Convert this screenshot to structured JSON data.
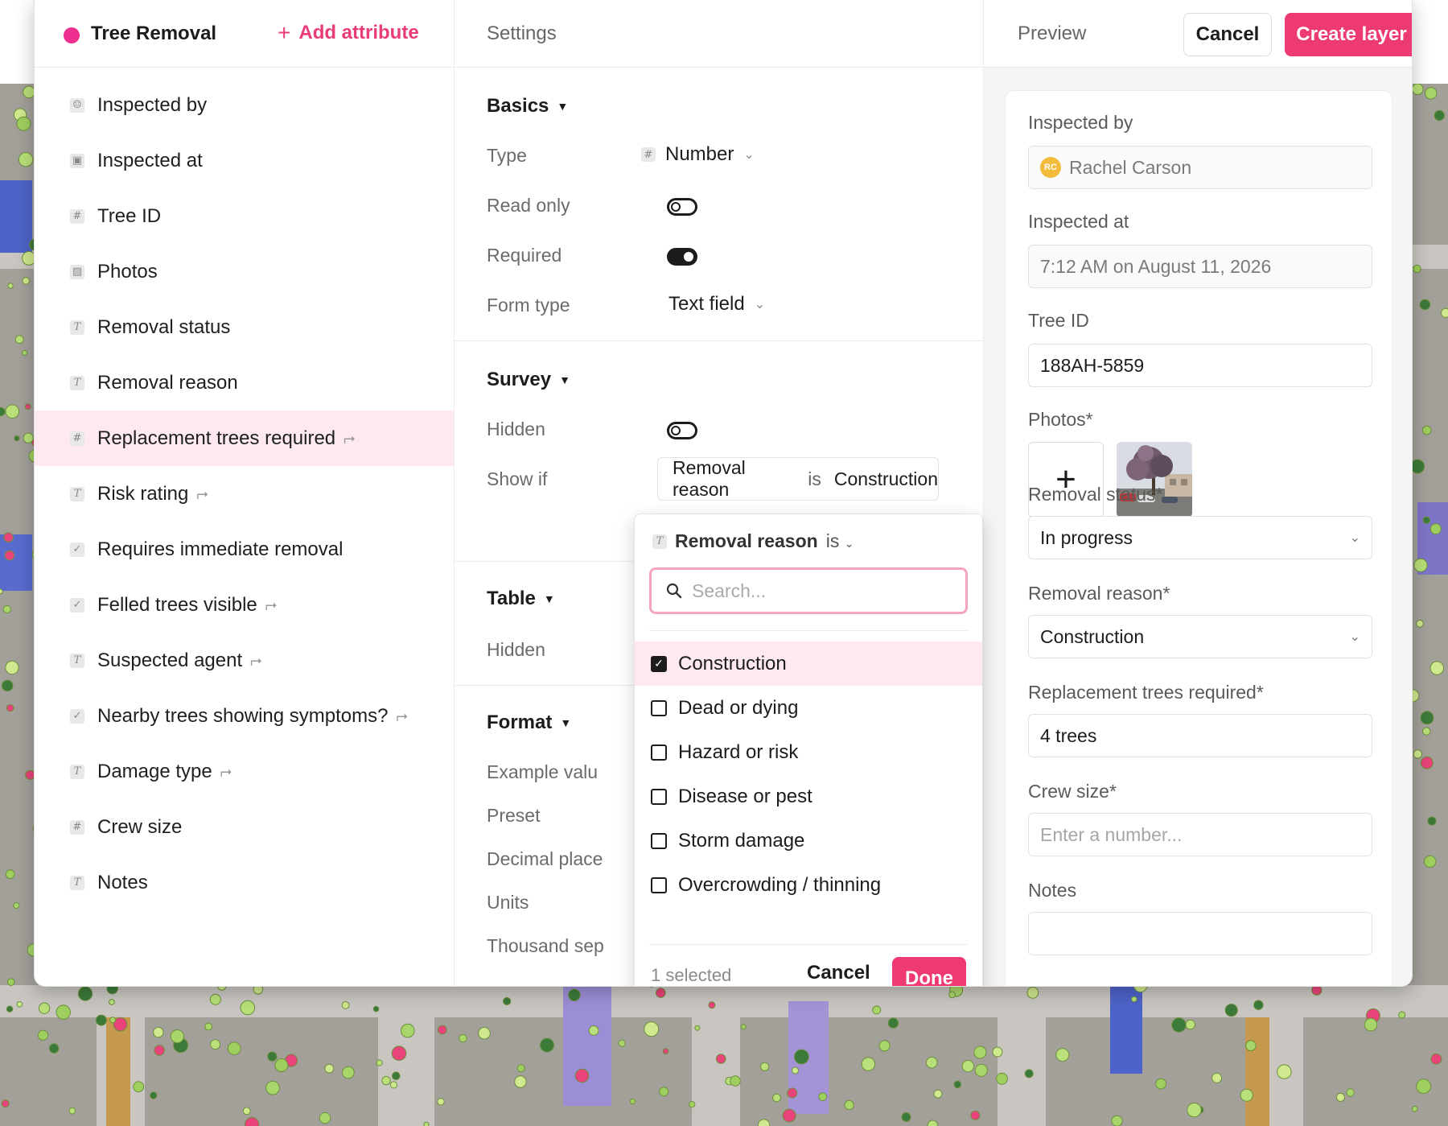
{
  "layer": {
    "name": "Tree Removal",
    "dot_color": "#ee2f8f",
    "add_attribute_label": "Add attribute"
  },
  "attributes": [
    {
      "label": "Inspected by",
      "icon": "person-icon",
      "glyph": "☺",
      "conditional": false
    },
    {
      "label": "Inspected at",
      "icon": "calendar-icon",
      "glyph": "▣",
      "conditional": false
    },
    {
      "label": "Tree ID",
      "icon": "number-icon",
      "glyph": "#",
      "conditional": false
    },
    {
      "label": "Photos",
      "icon": "image-icon",
      "glyph": "▨",
      "conditional": false
    },
    {
      "label": "Removal status",
      "icon": "text-icon",
      "glyph": "T",
      "conditional": false
    },
    {
      "label": "Removal reason",
      "icon": "text-icon",
      "glyph": "T",
      "conditional": false
    },
    {
      "label": "Replacement trees required",
      "icon": "number-icon",
      "glyph": "#",
      "conditional": true,
      "selected": true
    },
    {
      "label": "Risk rating",
      "icon": "text-icon",
      "glyph": "T",
      "conditional": true
    },
    {
      "label": "Requires immediate removal",
      "icon": "checkbox-icon",
      "glyph": "✓",
      "conditional": false
    },
    {
      "label": "Felled trees visible",
      "icon": "checkbox-icon",
      "glyph": "✓",
      "conditional": true
    },
    {
      "label": "Suspected agent",
      "icon": "text-icon",
      "glyph": "T",
      "conditional": true
    },
    {
      "label": "Nearby trees showing symptoms?",
      "icon": "checkbox-icon",
      "glyph": "✓",
      "conditional": true
    },
    {
      "label": "Damage type",
      "icon": "text-icon",
      "glyph": "T",
      "conditional": true
    },
    {
      "label": "Crew size",
      "icon": "number-icon",
      "glyph": "#",
      "conditional": false
    },
    {
      "label": "Notes",
      "icon": "text-icon",
      "glyph": "T",
      "conditional": false
    }
  ],
  "settings": {
    "title": "Settings",
    "basics": {
      "title": "Basics",
      "type_label": "Type",
      "type_value": "Number",
      "read_only_label": "Read only",
      "read_only": false,
      "required_label": "Required",
      "required": true,
      "form_type_label": "Form type",
      "form_type_value": "Text field"
    },
    "survey": {
      "title": "Survey",
      "hidden_label": "Hidden",
      "hidden": false,
      "show_if_label": "Show if",
      "show_if": {
        "field": "Removal reason",
        "op": "is",
        "value": "Construction"
      }
    },
    "table": {
      "title": "Table",
      "hidden_label": "Hidden"
    },
    "format": {
      "title": "Format",
      "rows": [
        "Example valu",
        "Preset",
        "Decimal place",
        "Units",
        "Thousand sep"
      ]
    }
  },
  "dropdown": {
    "field": "Removal reason",
    "op": "is",
    "search_placeholder": "Search...",
    "options": [
      {
        "label": "Construction",
        "checked": true
      },
      {
        "label": "Dead or dying",
        "checked": false
      },
      {
        "label": "Hazard or risk",
        "checked": false
      },
      {
        "label": "Disease or pest",
        "checked": false
      },
      {
        "label": "Storm damage",
        "checked": false
      },
      {
        "label": "Overcrowding / thinning",
        "checked": false
      }
    ],
    "selected_count_text": "1 selected",
    "cancel_label": "Cancel",
    "done_label": "Done"
  },
  "preview": {
    "title": "Preview",
    "cancel_label": "Cancel",
    "create_label": "Create layer",
    "accent_color": "#ee3a72",
    "fields": {
      "inspected_by_label": "Inspected by",
      "inspected_by_initials": "RC",
      "inspected_by_value": "Rachel Carson",
      "inspected_at_label": "Inspected at",
      "inspected_at_value": "7:12 AM on August 11, 2026",
      "tree_id_label": "Tree ID",
      "tree_id_value": "188AH-5859",
      "photos_label": "Photos*",
      "removal_status_label": "Removal status*",
      "removal_status_value": "In progress",
      "removal_reason_label": "Removal reason*",
      "removal_reason_value": "Construction",
      "replacement_label": "Replacement trees required*",
      "replacement_value": "4 trees",
      "crew_size_label": "Crew size*",
      "crew_size_placeholder": "Enter a number...",
      "notes_label": "Notes"
    }
  }
}
